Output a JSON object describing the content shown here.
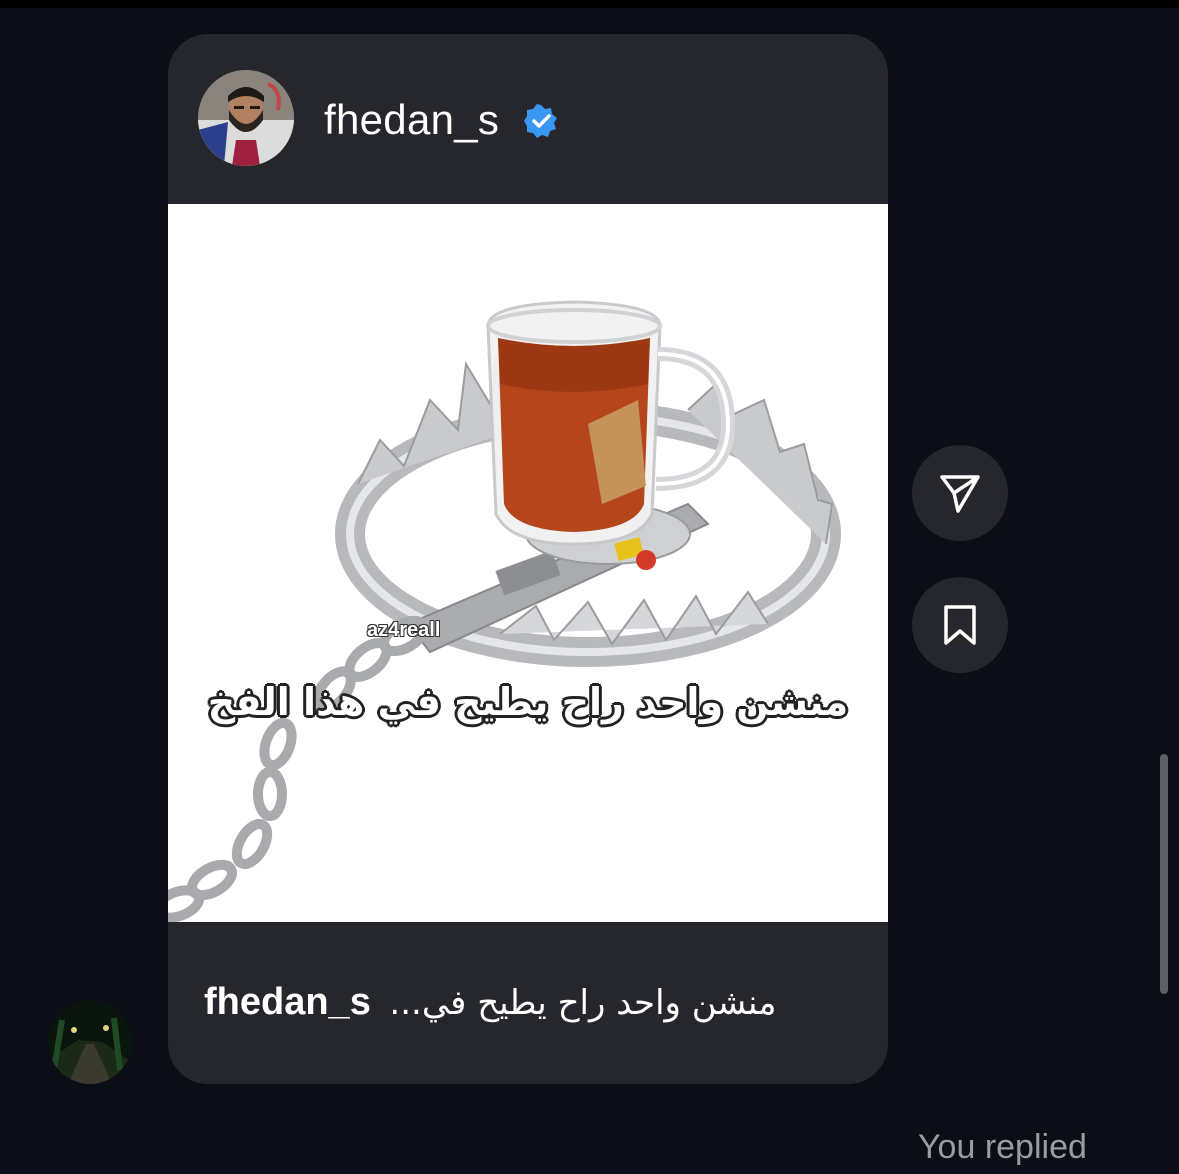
{
  "post": {
    "username": "fhedan_s",
    "verified_icon": "verified-badge-icon",
    "image_watermark": "az4reall",
    "image_overlay_text": "منشن واحد راح يطيح في هذا الفخ",
    "caption_user": "fhedan_s",
    "caption_text": "منشن واحد راح يطيح في..."
  },
  "actions": {
    "share_icon": "send-icon",
    "save_icon": "bookmark-icon"
  },
  "status": {
    "replied_label": "You replied"
  },
  "colors": {
    "background": "#0b0e16",
    "card": "#26272c",
    "verified_blue": "#3897f0",
    "muted_text": "#9a9ca4"
  }
}
